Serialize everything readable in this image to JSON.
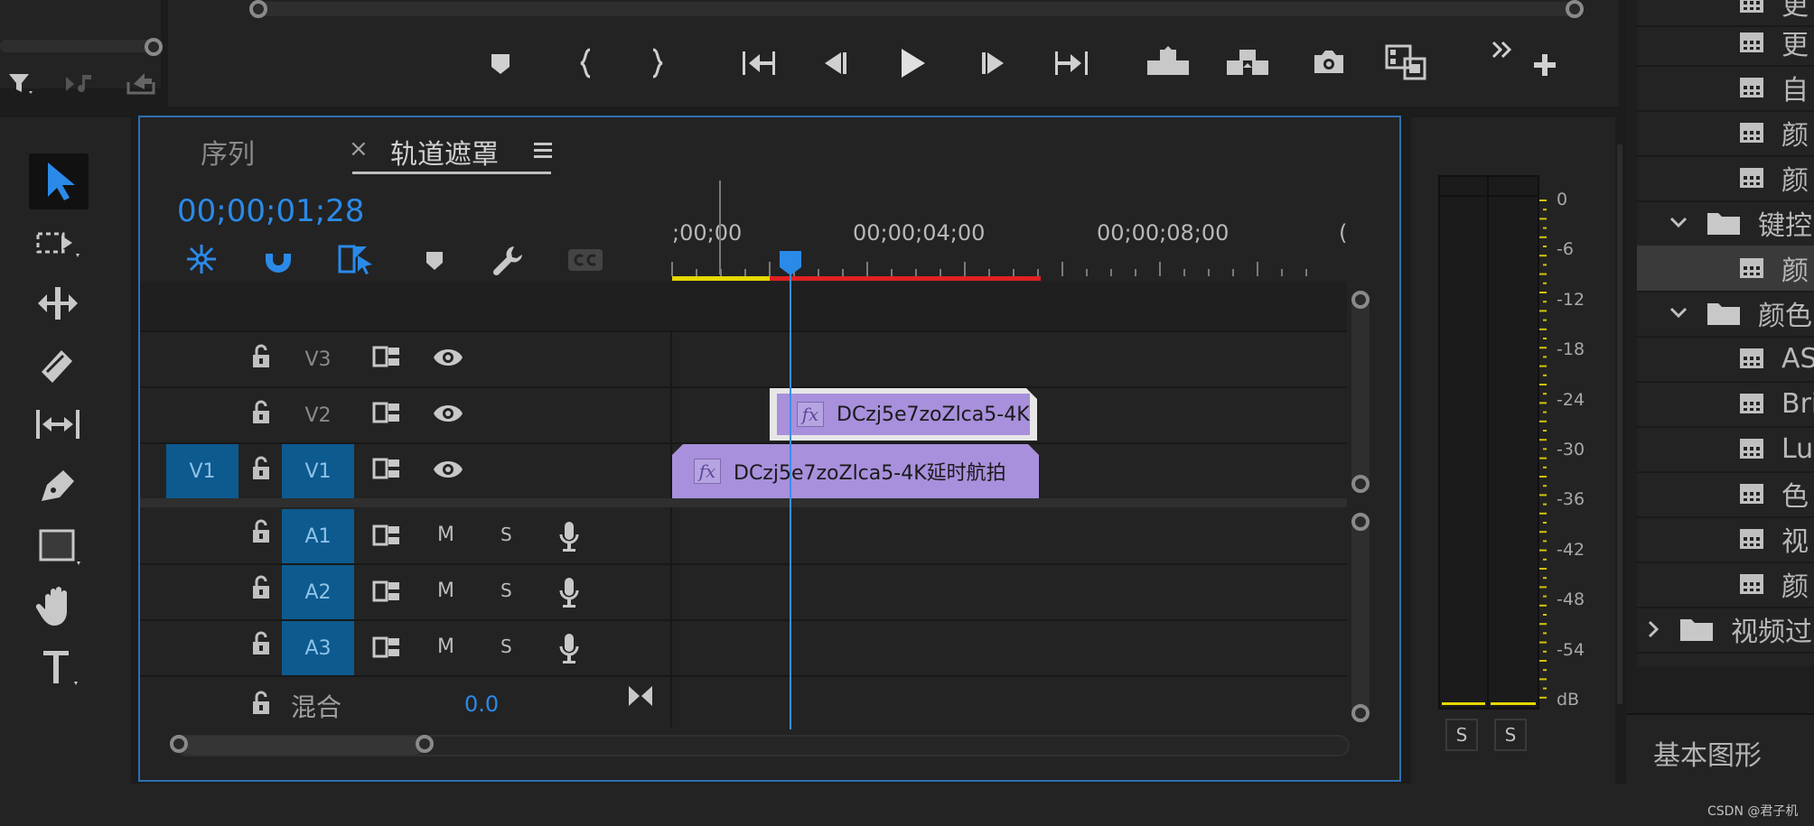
{
  "panel_tabs": {
    "sequence": "序列",
    "close_symbol": "×",
    "track_matte": "轨道遮罩"
  },
  "timecode": "00;00;01;28",
  "ruler": {
    "t0": ";00;00",
    "t4": "00;00;04;00",
    "t8": "00;00;08;00",
    "t12": "("
  },
  "tracks": {
    "video": [
      {
        "target": "",
        "name": "V3"
      },
      {
        "target": "",
        "name": "V2"
      },
      {
        "target": "V1",
        "name": "V1"
      }
    ],
    "audio": [
      {
        "name": "A1",
        "m": "M",
        "s": "S"
      },
      {
        "name": "A2",
        "m": "M",
        "s": "S"
      },
      {
        "name": "A3",
        "m": "M",
        "s": "S"
      }
    ],
    "mix": {
      "label": "混合",
      "value": "0.0"
    }
  },
  "clips": {
    "v2_clip": "DCzj5e7zoZlca5-4K",
    "v1_clip": "DCzj5e7zoZlca5-4K延时航拍"
  },
  "meter": {
    "scale": [
      "0",
      "-6",
      "-12",
      "-18",
      "-24",
      "-30",
      "-36",
      "-42",
      "-48",
      "-54",
      "dB"
    ],
    "solo_left": "S",
    "solo_right": "S"
  },
  "right_panel": {
    "items": [
      "更",
      "更",
      "自",
      "颜",
      "颜",
      "键控",
      "颜",
      "颜色",
      "ASC",
      "Bri",
      "Lur",
      "色",
      "视",
      "颜",
      "视频过"
    ],
    "essential_graphics": "基本图形"
  },
  "watermark": "CSDN @君子机",
  "colors": {
    "accent": "#2b8ae8",
    "clip": "#a890dc",
    "target": "#0d5a8f",
    "workarea_yellow": "#e6d800",
    "render_red": "#e02020"
  }
}
